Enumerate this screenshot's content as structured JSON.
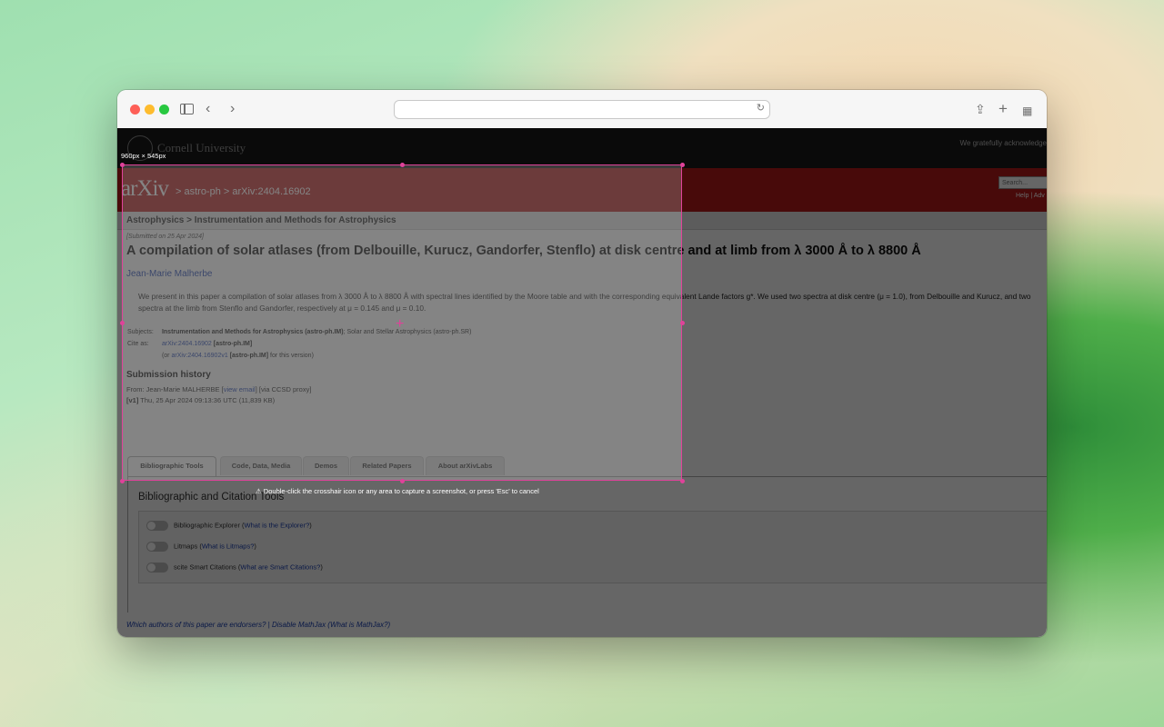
{
  "browser": {
    "address_value": "",
    "icons": [
      "sidebar-icon",
      "back-icon",
      "forward-icon",
      "reload-icon",
      "share-icon",
      "new-tab-icon",
      "tab-overview-icon"
    ]
  },
  "cornell": {
    "name": "Cornell University",
    "ack": "We gratefully acknowledge"
  },
  "arxiv": {
    "logo": "arXiv",
    "crumbs": "> astro-ph > arXiv:2404.16902",
    "search_placeholder": "Search...",
    "help": "Help | Adv"
  },
  "paper": {
    "subject_heading": "Astrophysics > Instrumentation and Methods for Astrophysics",
    "submitted": "[Submitted on 25 Apr 2024]",
    "title": "A compilation of solar atlases (from Delbouille, Kurucz, Gandorfer, Stenflo) at disk centre and at limb from λ 3000 Å to λ 8800 Å",
    "author": "Jean-Marie Malherbe",
    "abstract": "We present in this paper a compilation of solar atlases from λ 3000 Å to λ 8800 Å with spectral lines identified by the Moore table and with the corresponding equivalent Lande factors g*. We used two spectra at disk centre (μ = 1.0), from Delbouille and Kurucz, and two spectra at the limb from Stenflo and Gandorfer, respectively at μ = 0.145 and μ = 0.10.",
    "subjects_label": "Subjects:",
    "subjects_main": "Instrumentation and Methods for Astrophysics (astro-ph.IM)",
    "subjects_rest": "; Solar and Stellar Astrophysics (astro-ph.SR)",
    "cite_label": "Cite as:",
    "cite_link": "arXiv:2404.16902",
    "cite_tag": "[astro-ph.IM]",
    "version_prefix": "(or",
    "version_link": "arXiv:2404.16902v1",
    "version_tag": "[astro-ph.IM]",
    "version_suffix": "for this version)",
    "history_title": "Submission history",
    "from_prefix": "From: Jean-Marie MALHERBE [",
    "from_link": "view email",
    "from_suffix": "] [via CCSD proxy]",
    "v1_label": "[v1]",
    "v1_text": "Thu, 25 Apr 2024 09:13:36 UTC (11,839 KB)"
  },
  "tabs": [
    {
      "label": "Bibliographic Tools",
      "active": true
    },
    {
      "label": "Code, Data, Media",
      "active": false
    },
    {
      "label": "Demos",
      "active": false
    },
    {
      "label": "Related Papers",
      "active": false
    },
    {
      "label": "About arXivLabs",
      "active": false
    }
  ],
  "panel": {
    "title": "Bibliographic and Citation Tools",
    "toggles": [
      {
        "label": "Bibliographic Explorer (",
        "link": "What is the Explorer?",
        "close": ")",
        "on": false
      },
      {
        "label": "Litmaps (",
        "link": "What is Litmaps?",
        "close": ")",
        "on": false
      },
      {
        "label": "scite Smart Citations (",
        "link": "What are Smart Citations?",
        "close": ")",
        "on": false
      }
    ]
  },
  "footer": {
    "links": "Which authors of this paper are endorsers? | Disable MathJax (What is MathJax?)"
  },
  "capture": {
    "size_label": "960px × 545px",
    "hint": "⚠ Double-click the crosshair icon or any area to capture a screenshot, or press 'Esc' to cancel",
    "accent": "#e0429a"
  }
}
